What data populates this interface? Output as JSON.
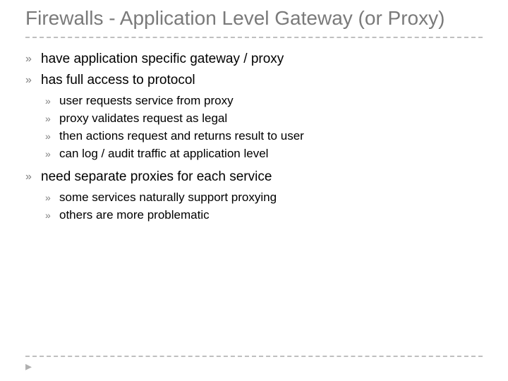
{
  "title": "Firewalls - Application Level Gateway (or Proxy)",
  "bullets": [
    {
      "text": "have application specific gateway / proxy"
    },
    {
      "text": "has full access to protocol",
      "sub": [
        "user requests service from proxy",
        "proxy validates request as legal",
        "then actions request and returns result to user",
        "can log / audit traffic at application level"
      ]
    },
    {
      "text": "need separate proxies for each service",
      "sub": [
        "some services naturally support proxying",
        "others are more problematic"
      ]
    }
  ]
}
